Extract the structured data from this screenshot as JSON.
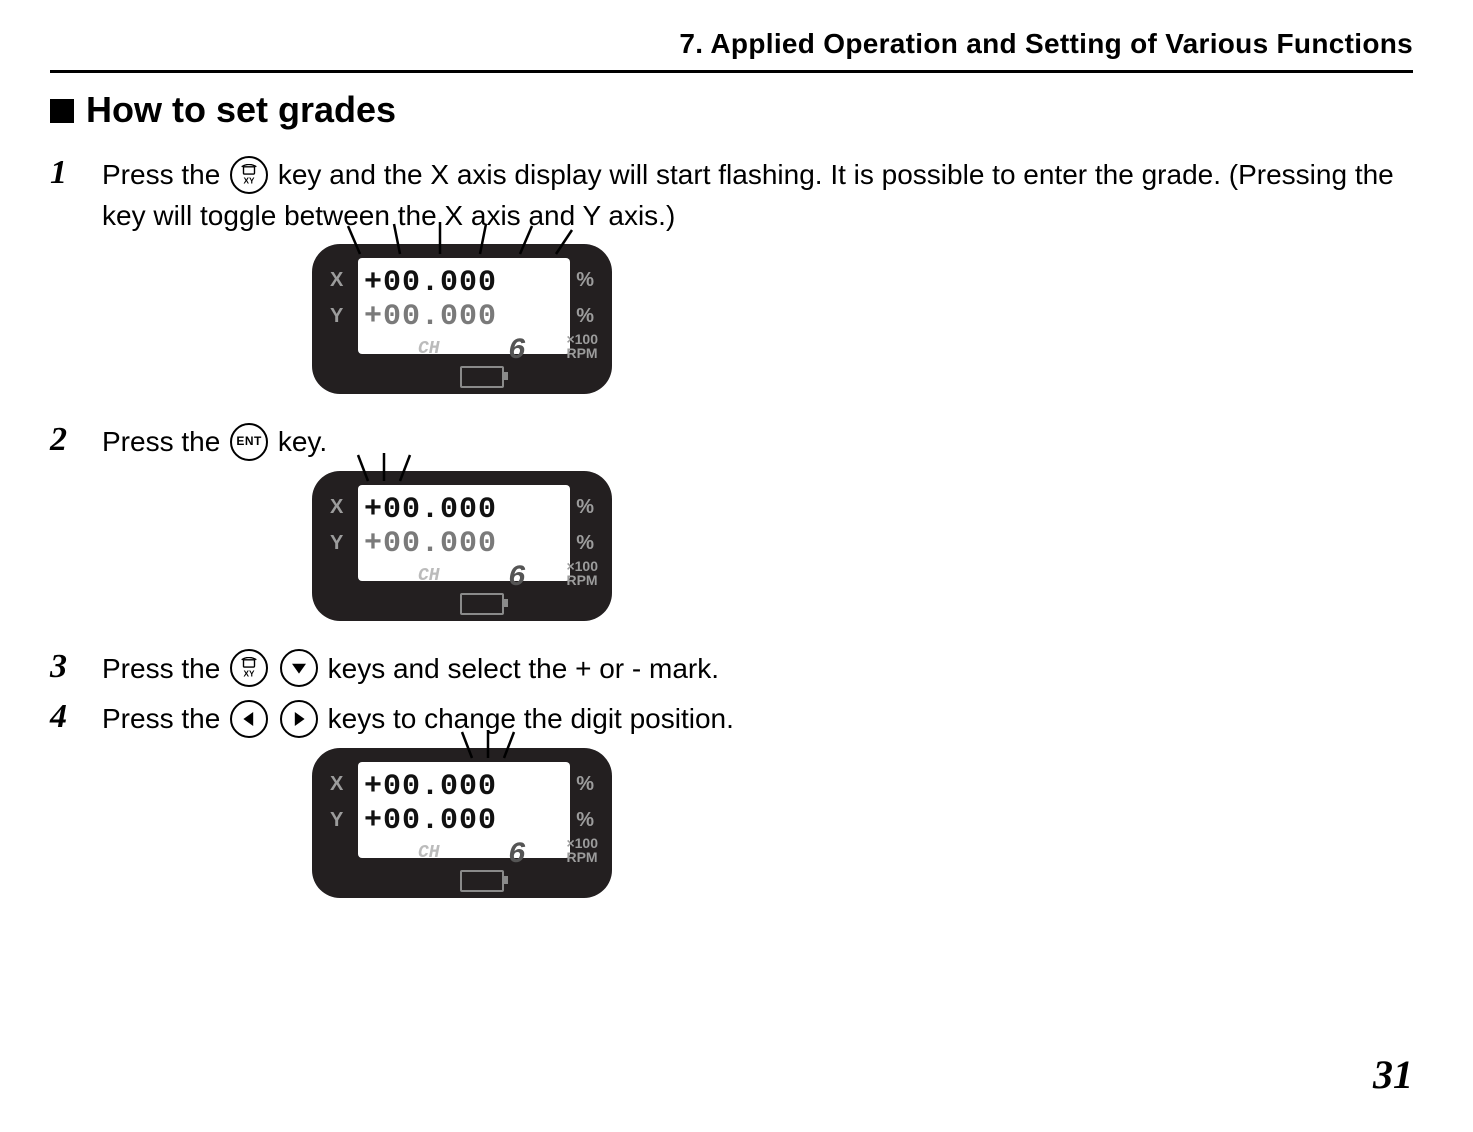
{
  "header": {
    "chapter": "7.  Applied Operation and Setting of Various Functions"
  },
  "section": {
    "title": "How to set grades"
  },
  "keys": {
    "xy_label": "XY",
    "ent_label": "ENT"
  },
  "steps": [
    {
      "num": "1",
      "parts": [
        "Press the ",
        {
          "key": "xy"
        },
        " key and the X axis display will start flashing. It is possible to enter the grade. (Pressing the key will toggle between the X axis and Y axis.)"
      ]
    },
    {
      "num": "2",
      "parts": [
        "Press the ",
        {
          "key": "ent"
        },
        " key."
      ]
    },
    {
      "num": "3",
      "parts": [
        "Press the ",
        {
          "key": "xy"
        },
        " ",
        {
          "key": "down"
        },
        "  keys and select the + or - mark."
      ]
    },
    {
      "num": "4",
      "parts": [
        "Press the ",
        {
          "key": "left"
        },
        " ",
        {
          "key": "right"
        },
        "  keys to change the digit position."
      ]
    }
  ],
  "display": {
    "labels": {
      "x": "X",
      "y": "Y",
      "pct": "%",
      "rpm_top": "×100",
      "rpm_bot": "RPM"
    },
    "rows": {
      "x_value": "+00.000",
      "y_value": "+00.000",
      "rpm_value": "6",
      "ch": "CH"
    }
  },
  "page_number": "31"
}
